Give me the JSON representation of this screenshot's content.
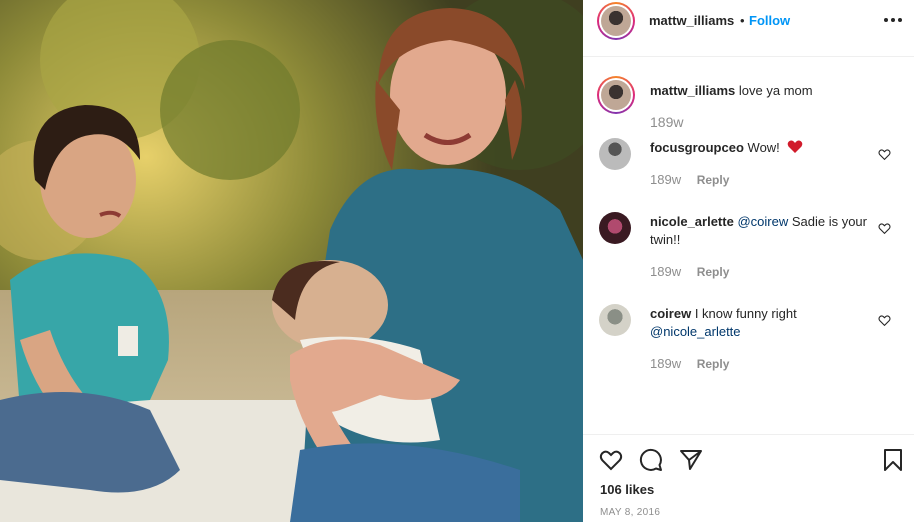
{
  "post": {
    "photo_icon": "photo-image",
    "author": "mattw_illiams",
    "dot": "•",
    "follow_label": "Follow",
    "more_icon": "more-options-icon"
  },
  "caption": {
    "user": "mattw_illiams",
    "text": "love ya mom",
    "time": "189w"
  },
  "comments": [
    {
      "user": "focusgroupceo",
      "text": "Wow!",
      "emoji": "red-heart-icon",
      "time": "189w",
      "reply": "Reply"
    },
    {
      "user": "nicole_arlette",
      "mention": "@coirew",
      "text": " Sadie is your twin!!",
      "time": "189w",
      "reply": "Reply"
    },
    {
      "user": "coirew",
      "text": "I know funny right ",
      "mention": "@nicole_arlette",
      "time": "189w",
      "reply": "Reply"
    }
  ],
  "actions": {
    "likes": "106 likes",
    "date": "MAY 8, 2016"
  },
  "colors": {
    "link_blue": "#0095f6",
    "mention": "#00376b",
    "muted": "#8e8e8e",
    "heart": "#ed4956"
  }
}
